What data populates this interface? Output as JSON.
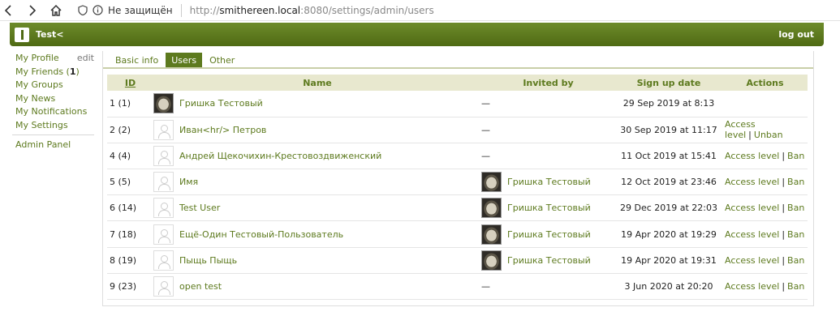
{
  "browser": {
    "insecure_label": "Не защищён",
    "url_scheme": "http://",
    "url_host": "smithereen.local",
    "url_rest": ":8080/settings/admin/users"
  },
  "header": {
    "site_name": "Test<",
    "logout": "log out"
  },
  "menu": {
    "profile": "My Profile",
    "edit": "edit",
    "friends": "My Friends (",
    "friends_count": "1",
    "friends_close": ")",
    "groups": "My Groups",
    "news": "My News",
    "notifications": "My Notifications",
    "settings": "My Settings",
    "admin": "Admin Panel"
  },
  "tabs": [
    "Basic info",
    "Users",
    "Other"
  ],
  "table": {
    "headers": {
      "id": "ID",
      "name": "Name",
      "invited_by": "Invited by",
      "signup": "Sign up date",
      "actions": "Actions"
    },
    "rows": [
      {
        "id": "1 (1)",
        "name": "Гришка Тестовый",
        "photo": true,
        "inviter": "—",
        "inviter_photo": false,
        "date": "29 Sep 2019 at 8:13",
        "action1": "",
        "action2": ""
      },
      {
        "id": "2 (2)",
        "name": "Иван<hr/> Петров",
        "photo": false,
        "inviter": "—",
        "inviter_photo": false,
        "date": "30 Sep 2019 at 11:17",
        "action1": "Access level",
        "action2": "Unban"
      },
      {
        "id": "4 (4)",
        "name": "Андрей Щекочихин-Крестовоздвиженский",
        "photo": false,
        "inviter": "—",
        "inviter_photo": false,
        "date": "11 Oct 2019 at 15:41",
        "action1": "Access level",
        "action2": "Ban"
      },
      {
        "id": "5 (5)",
        "name": "Имя",
        "photo": false,
        "inviter": "Гришка Тестовый",
        "inviter_photo": true,
        "date": "12 Oct 2019 at 23:46",
        "action1": "Access level",
        "action2": "Ban"
      },
      {
        "id": "6 (14)",
        "name": "Test User",
        "photo": false,
        "inviter": "Гришка Тестовый",
        "inviter_photo": true,
        "date": "29 Dec 2019 at 22:03",
        "action1": "Access level",
        "action2": "Ban"
      },
      {
        "id": "7 (18)",
        "name": "Ещё-Один Тестовый-Пользователь",
        "photo": false,
        "inviter": "Гришка Тестовый",
        "inviter_photo": true,
        "date": "19 Apr 2020 at 19:29",
        "action1": "Access level",
        "action2": "Ban"
      },
      {
        "id": "8 (19)",
        "name": "Пыщь Пыщь",
        "photo": false,
        "inviter": "Гришка Тестовый",
        "inviter_photo": true,
        "date": "19 Apr 2020 at 19:31",
        "action1": "Access level",
        "action2": "Ban"
      },
      {
        "id": "9 (23)",
        "name": "open test",
        "photo": false,
        "inviter": "—",
        "inviter_photo": false,
        "date": "3 Jun 2020 at 20:20",
        "action1": "Access level",
        "action2": "Ban"
      }
    ]
  }
}
